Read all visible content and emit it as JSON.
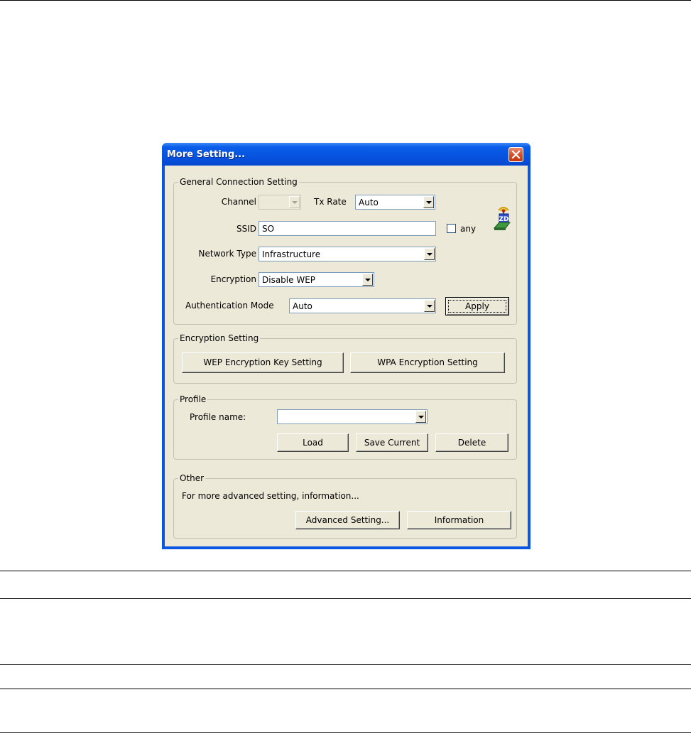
{
  "window": {
    "title": "More Setting..."
  },
  "general": {
    "legend": "General Connection Setting",
    "channel_label": "Channel",
    "channel_value": "",
    "txrate_label": "Tx Rate",
    "txrate_value": "Auto",
    "ssid_label": "SSID",
    "ssid_value": "SO",
    "any_label": "any",
    "any_checked": false,
    "network_type_label": "Network Type",
    "network_type_value": "Infrastructure",
    "encryption_label": "Encryption",
    "encryption_value": "Disable WEP",
    "auth_mode_label": "Authentication Mode",
    "auth_mode_value": "Auto",
    "apply_label": "Apply",
    "logo_text": "ZD"
  },
  "encryption_setting": {
    "legend": "Encryption Setting",
    "wep_button": "WEP Encryption Key Setting",
    "wpa_button": "WPA Encryption Setting"
  },
  "profile": {
    "legend": "Profile",
    "name_label": "Profile name:",
    "name_value": "",
    "load_button": "Load",
    "save_button": "Save Current",
    "delete_button": "Delete"
  },
  "other": {
    "legend": "Other",
    "description": "For more advanced setting, information...",
    "advanced_button": "Advanced Setting...",
    "information_button": "Information"
  },
  "colors": {
    "titlebar": "#0653e0",
    "dialog_bg": "#ece9d8",
    "close_button": "#d3461f"
  }
}
